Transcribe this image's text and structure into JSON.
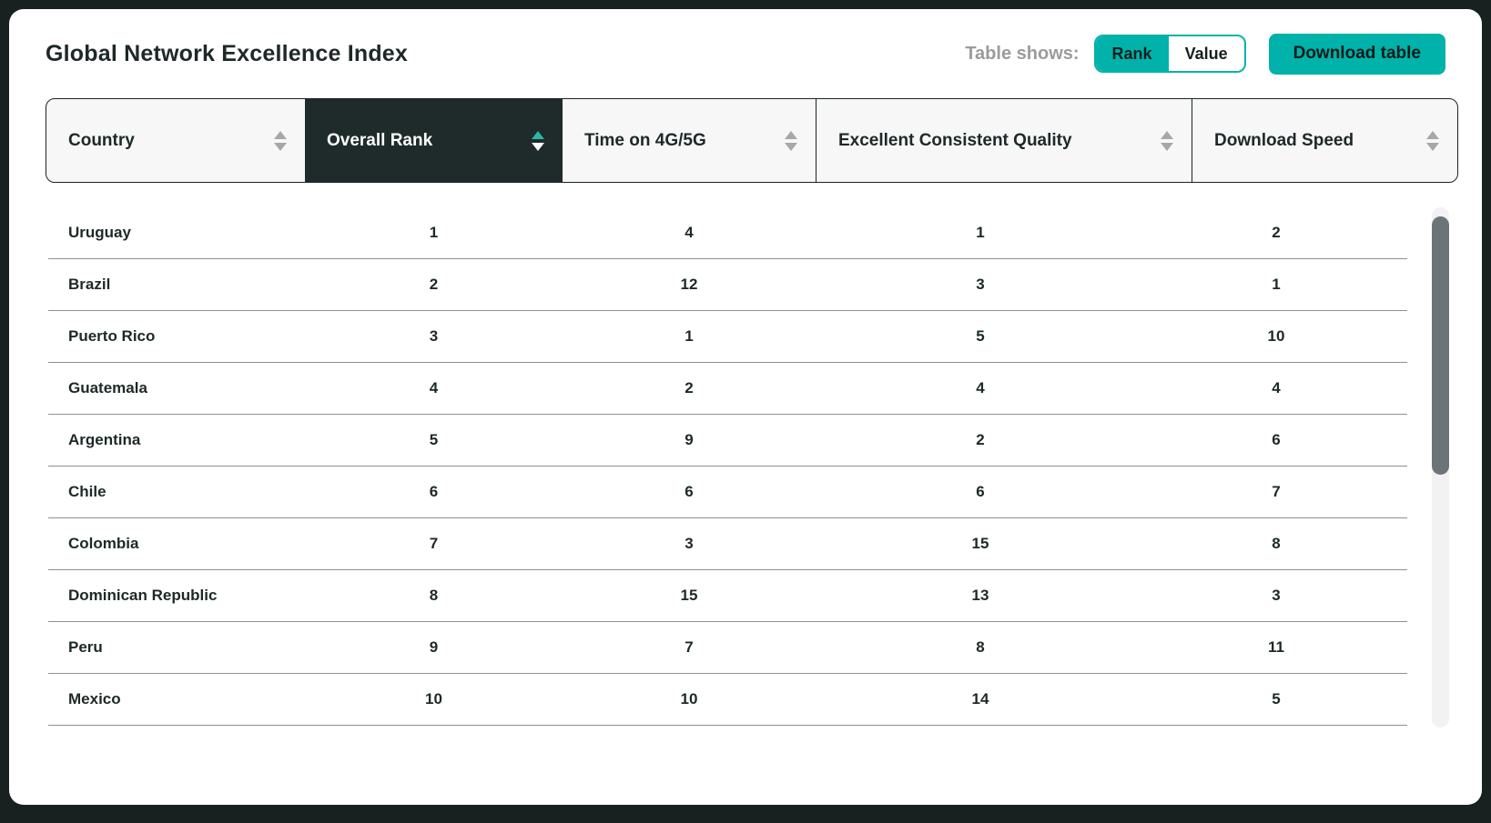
{
  "header": {
    "title": "Global Network Excellence Index",
    "table_shows_label": "Table shows:",
    "toggle": {
      "rank_label": "Rank",
      "value_label": "Value",
      "selected": "Rank"
    },
    "download_label": "Download table"
  },
  "table": {
    "columns": [
      {
        "label": "Country",
        "sort_active": false
      },
      {
        "label": "Overall Rank",
        "sort_active": true
      },
      {
        "label": "Time on 4G/5G",
        "sort_active": false
      },
      {
        "label": "Excellent Consistent Quality",
        "sort_active": false
      },
      {
        "label": "Download Speed",
        "sort_active": false
      }
    ],
    "rows": [
      {
        "country": "Uruguay",
        "overall_rank": 1,
        "time_on_4g_5g": 4,
        "excellent_consistent_quality": 1,
        "download_speed": 2
      },
      {
        "country": "Brazil",
        "overall_rank": 2,
        "time_on_4g_5g": 12,
        "excellent_consistent_quality": 3,
        "download_speed": 1
      },
      {
        "country": "Puerto Rico",
        "overall_rank": 3,
        "time_on_4g_5g": 1,
        "excellent_consistent_quality": 5,
        "download_speed": 10
      },
      {
        "country": "Guatemala",
        "overall_rank": 4,
        "time_on_4g_5g": 2,
        "excellent_consistent_quality": 4,
        "download_speed": 4
      },
      {
        "country": "Argentina",
        "overall_rank": 5,
        "time_on_4g_5g": 9,
        "excellent_consistent_quality": 2,
        "download_speed": 6
      },
      {
        "country": "Chile",
        "overall_rank": 6,
        "time_on_4g_5g": 6,
        "excellent_consistent_quality": 6,
        "download_speed": 7
      },
      {
        "country": "Colombia",
        "overall_rank": 7,
        "time_on_4g_5g": 3,
        "excellent_consistent_quality": 15,
        "download_speed": 8
      },
      {
        "country": "Dominican Republic",
        "overall_rank": 8,
        "time_on_4g_5g": 15,
        "excellent_consistent_quality": 13,
        "download_speed": 3
      },
      {
        "country": "Peru",
        "overall_rank": 9,
        "time_on_4g_5g": 7,
        "excellent_consistent_quality": 8,
        "download_speed": 11
      },
      {
        "country": "Mexico",
        "overall_rank": 10,
        "time_on_4g_5g": 10,
        "excellent_consistent_quality": 14,
        "download_speed": 5
      }
    ]
  },
  "colors": {
    "accent_teal": "#00b2a9",
    "sort_active_arrow_teal": "#2bb6a8",
    "dark_text": "#1d2928",
    "header_dark_cell": "#1e2b2a",
    "frame_background": "#182120",
    "row_divider": "#8c9191",
    "scrollbar_thumb": "#6d7477"
  }
}
